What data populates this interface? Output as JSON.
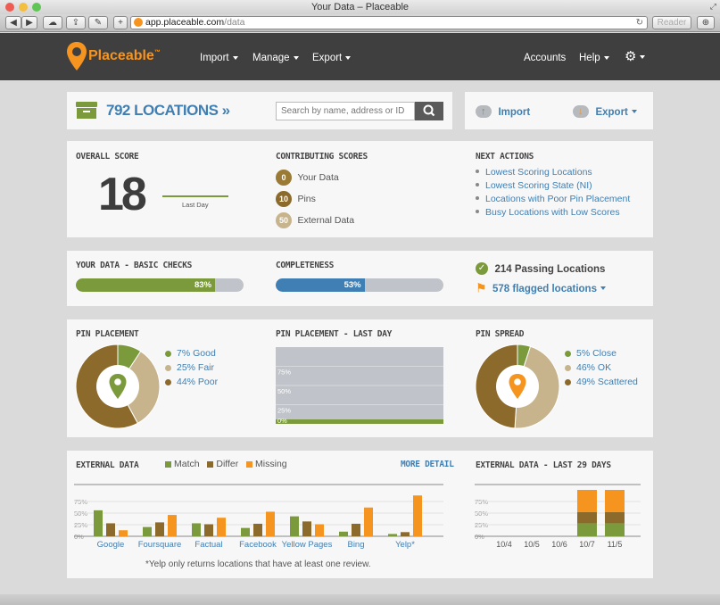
{
  "browser": {
    "window_title": "Your Data – Placeable",
    "url_host": "app.placeable.com",
    "url_path": "/data",
    "reader_label": "Reader"
  },
  "nav": {
    "brand": "Placeable",
    "trademark": "™",
    "items": [
      {
        "label": "Import"
      },
      {
        "label": "Manage"
      },
      {
        "label": "Export"
      }
    ],
    "accounts": "Accounts",
    "help": "Help"
  },
  "locations": {
    "count_label": "792 LOCATIONS",
    "search_placeholder": "Search by name, address or ID"
  },
  "import_export": {
    "import_label": "Import",
    "export_label": "Export"
  },
  "score": {
    "title": "OVERALL SCORE",
    "value": "18",
    "trend_label": "Last Day"
  },
  "contributing": {
    "title": "CONTRIBUTING SCORES",
    "items": [
      {
        "badge": "0",
        "label": "Your Data",
        "color": "#9a7a34"
      },
      {
        "badge": "10",
        "label": "Pins",
        "color": "#8c6a2c"
      },
      {
        "badge": "50",
        "label": "External Data",
        "color": "#c7b48c"
      }
    ]
  },
  "next_actions": {
    "title": "NEXT ACTIONS",
    "items": [
      "Lowest Scoring Locations",
      "Lowest Scoring State (NI)",
      "Locations with Poor Pin Placement",
      "Busy Locations with Low Scores"
    ]
  },
  "basic_checks": {
    "title": "YOUR DATA - BASIC CHECKS",
    "percent_label": "83%",
    "fraction": 0.83,
    "color": "#7b9a3b"
  },
  "completeness": {
    "title": "COMPLETENESS",
    "percent_label": "53%",
    "fraction": 0.53,
    "color": "#3f7fb3"
  },
  "status": {
    "passing": "214 Passing Locations",
    "flagged": "578 flagged locations"
  },
  "pin_placement": {
    "title": "PIN PLACEMENT",
    "legend": [
      "7% Good",
      "25% Fair",
      "44% Poor"
    ]
  },
  "pin_last_day": {
    "title": "PIN PLACEMENT - LAST DAY",
    "ticks": [
      "75%",
      "50%",
      "25%",
      "0%"
    ]
  },
  "pin_spread": {
    "title": "PIN SPREAD",
    "legend": [
      "5% Close",
      "46% OK",
      "49% Scattered"
    ]
  },
  "external": {
    "title": "EXTERNAL DATA",
    "more_detail": "MORE DETAIL",
    "legend": [
      "Match",
      "Differ",
      "Missing"
    ],
    "footnote": "*Yelp only returns locations that have at least one review."
  },
  "external_last29": {
    "title": "EXTERNAL DATA - LAST 29 DAYS"
  },
  "chart_data": [
    {
      "type": "pie",
      "title": "PIN PLACEMENT",
      "labels": [
        "Good",
        "Fair",
        "Poor"
      ],
      "values": [
        7,
        25,
        44
      ],
      "colors": [
        "#7b9a3b",
        "#c7b48c",
        "#8c6a2c"
      ]
    },
    {
      "type": "area",
      "title": "PIN PLACEMENT - LAST DAY",
      "yticks": [
        "75%",
        "50%",
        "25%",
        "0%"
      ],
      "ylim": [
        0,
        100
      ],
      "series": [
        {
          "name": "Good",
          "values": [
            5
          ],
          "color": "#7b9a3b"
        },
        {
          "name": "Fair",
          "values": [
            95
          ],
          "color": "#c0c4ca"
        }
      ]
    },
    {
      "type": "pie",
      "title": "PIN SPREAD",
      "labels": [
        "Close",
        "OK",
        "Scattered"
      ],
      "values": [
        5,
        46,
        49
      ],
      "colors": [
        "#7b9a3b",
        "#c7b48c",
        "#8c6a2c"
      ]
    },
    {
      "type": "bar",
      "title": "EXTERNAL DATA",
      "categories": [
        "Google",
        "Foursquare",
        "Factual",
        "Facebook",
        "Yellow Pages",
        "Bing",
        "Yelp*"
      ],
      "yticks": [
        "75%",
        "50%",
        "25%",
        "0%"
      ],
      "ylim": [
        0,
        100
      ],
      "series": [
        {
          "name": "Match",
          "values": [
            56,
            20,
            28,
            18,
            43,
            10,
            5
          ],
          "color": "#7b9a3b"
        },
        {
          "name": "Differ",
          "values": [
            28,
            30,
            26,
            27,
            32,
            27,
            9
          ],
          "color": "#8c6a2c"
        },
        {
          "name": "Missing",
          "values": [
            13,
            46,
            40,
            53,
            26,
            62,
            88
          ],
          "color": "#f5941e"
        }
      ]
    },
    {
      "type": "bar",
      "title": "EXTERNAL DATA - LAST 29 DAYS",
      "stacked": true,
      "categories": [
        "10/4",
        "10/5",
        "10/6",
        "10/7",
        "11/5"
      ],
      "yticks": [
        "75%",
        "50%",
        "25%",
        "0%"
      ],
      "ylim": [
        0,
        100
      ],
      "series": [
        {
          "name": "Match",
          "values": [
            0,
            0,
            0,
            28,
            28
          ],
          "color": "#7b9a3b"
        },
        {
          "name": "Differ",
          "values": [
            0,
            0,
            0,
            24,
            24
          ],
          "color": "#8c6a2c"
        },
        {
          "name": "Missing",
          "values": [
            0,
            0,
            0,
            48,
            48
          ],
          "color": "#f5941e"
        }
      ]
    }
  ]
}
